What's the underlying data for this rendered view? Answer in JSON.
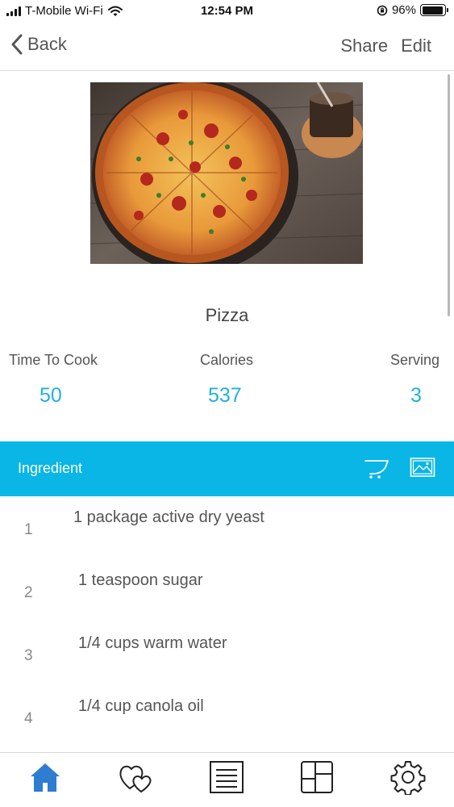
{
  "status_bar": {
    "carrier": "T-Mobile Wi-Fi",
    "time": "12:54 PM",
    "battery": "96%",
    "battery_level": 0.96
  },
  "nav": {
    "back_label": "Back",
    "share_label": "Share",
    "edit_label": "Edit"
  },
  "recipe": {
    "title": "Pizza",
    "stats": [
      {
        "label": "Time To Cook",
        "value": "50"
      },
      {
        "label": "Calories",
        "value": "537"
      },
      {
        "label": "Serving",
        "value": "3"
      }
    ]
  },
  "ingredients": {
    "header": "Ingredient",
    "header_icons": [
      "cart-icon",
      "image-icon"
    ],
    "items": [
      {
        "number": "1",
        "text": "1 package active dry yeast"
      },
      {
        "number": "2",
        "text": "1 teaspoon sugar"
      },
      {
        "number": "3",
        "text": "1/4 cups warm water"
      },
      {
        "number": "4",
        "text": "1/4 cup canola oil"
      }
    ]
  },
  "tab_bar": {
    "tabs": [
      "home-icon",
      "favorites-icon",
      "list-icon",
      "categories-icon",
      "settings-icon"
    ],
    "active": "home-icon"
  },
  "colors": {
    "accent": "#09b6e6",
    "value_text": "#21b1de",
    "active_tab": "#2f7cd3",
    "inactive_tab": "#222222"
  }
}
